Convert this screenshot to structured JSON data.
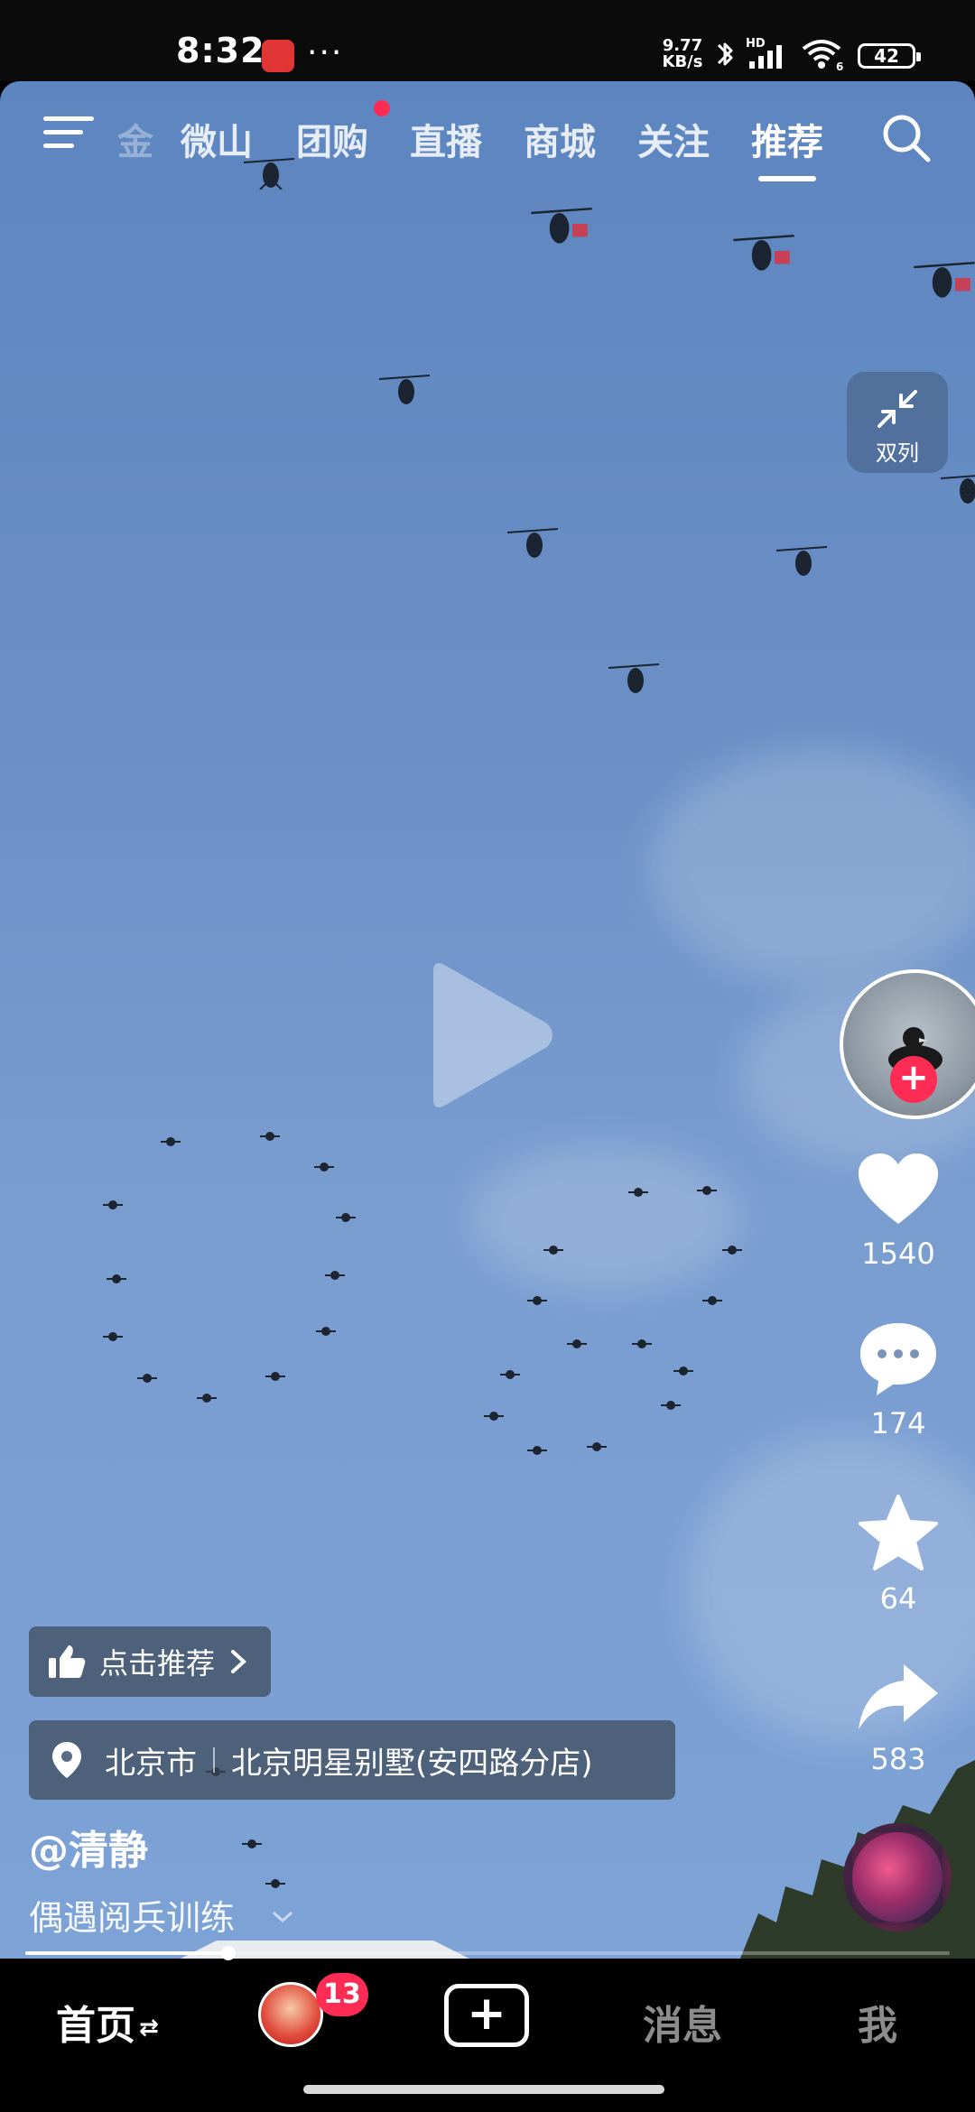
{
  "status_bar": {
    "time": "8:32",
    "more": "···",
    "net_speed_value": "9.77",
    "net_speed_unit": "KB/s",
    "signal_label": "HD",
    "wifi_label": "6",
    "battery": "42"
  },
  "top_nav": {
    "partial_tab": "金",
    "tabs": [
      "微山",
      "团购",
      "直播",
      "商城",
      "关注",
      "推荐"
    ],
    "active_tab_index": 5,
    "red_dot_tab_index": 1
  },
  "dual_column": {
    "label": "双列"
  },
  "actions": {
    "likes": "1540",
    "comments": "174",
    "favorites": "64",
    "shares": "583"
  },
  "recommend_chip": {
    "label": "点击推荐"
  },
  "location": {
    "city": "北京市",
    "place": "北京明星别墅(安四路分店)"
  },
  "post": {
    "author": "@清静",
    "description": "偶遇阅兵训练"
  },
  "progress": {
    "played_fraction": 0.22
  },
  "bottom_nav": {
    "home": "首页",
    "home_arrows": "⇄",
    "friends_badge": "13",
    "plus": "+",
    "messages": "消息",
    "me": "我"
  },
  "colors": {
    "accent": "#fe2c55",
    "sky": "#6b90c6"
  }
}
